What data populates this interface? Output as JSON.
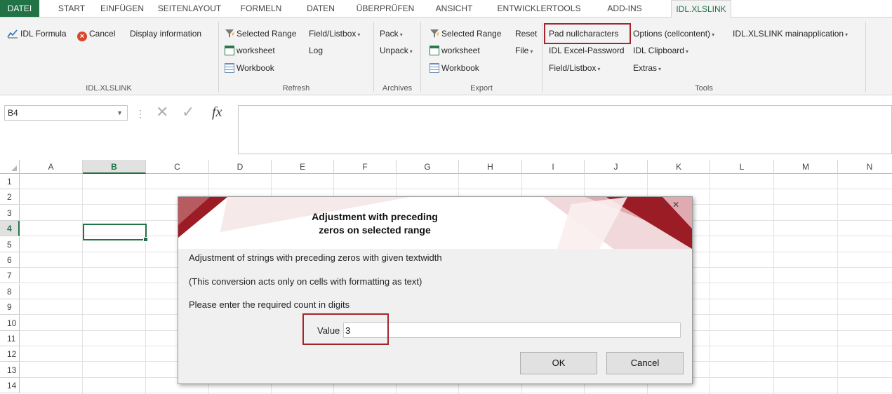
{
  "tabs": [
    "DATEI",
    "START",
    "EINFÜGEN",
    "SEITENLAYOUT",
    "FORMELN",
    "DATEN",
    "ÜBERPRÜFEN",
    "ANSICHT",
    "ENTWICKLERTOOLS",
    "ADD-INS",
    "IDL.XLSLINK"
  ],
  "ribbon": {
    "idl_formula": "IDL Formula",
    "cancel": "Cancel",
    "display_information": "Display information",
    "group_idlxlslink": "IDL.XLSLINK",
    "refresh_selected_range": "Selected Range",
    "refresh_worksheet": "worksheet",
    "refresh_workbook": "Workbook",
    "refresh_field_listbox": "Field/Listbox",
    "refresh_log": "Log",
    "group_refresh": "Refresh",
    "pack": "Pack",
    "unpack": "Unpack",
    "group_archives": "Archives",
    "export_selected_range": "Selected Range",
    "export_worksheet": "worksheet",
    "export_workbook": "Workbook",
    "reset": "Reset",
    "file": "File",
    "group_export": "Export",
    "pad_nullcharacters": "Pad nullcharacters",
    "options_cellcontent": "Options (cellcontent)",
    "mainapplication": "IDL.XLSLINK mainapplication",
    "excel_password": "IDL Excel-Password",
    "clipboard": "IDL Clipboard",
    "tools_field_listbox": "Field/Listbox",
    "extras": "Extras",
    "group_tools": "Tools"
  },
  "formula_bar": {
    "name_box": "B4",
    "fx": "fx",
    "cancel_glyph": "✕",
    "enter_glyph": "✓",
    "formula": ""
  },
  "grid": {
    "columns": [
      "A",
      "B",
      "C",
      "D",
      "E",
      "F",
      "G",
      "H",
      "I",
      "J",
      "K",
      "L",
      "M",
      "N"
    ],
    "rows": [
      "1",
      "2",
      "3",
      "4",
      "5",
      "6",
      "7",
      "8",
      "9",
      "10",
      "11",
      "12",
      "13",
      "14"
    ],
    "active_column": "B",
    "active_row": "4"
  },
  "dialog": {
    "title_line1": "Adjustment with preceding",
    "title_line2": "zeros on selected range",
    "line1": "Adjustment of strings with preceding zeros with given textwidth",
    "line2": "(This conversion acts only on cells with formatting as text)",
    "line3": "Please enter the required count in digits",
    "value_label": "Value",
    "value": "3",
    "ok": "OK",
    "cancel": "Cancel",
    "minimize": "_",
    "maximize": "□",
    "close": "✕"
  },
  "colors": {
    "excel_green": "#217346",
    "highlight": "#a4262c",
    "dialog_accent": "#9b1c24"
  }
}
